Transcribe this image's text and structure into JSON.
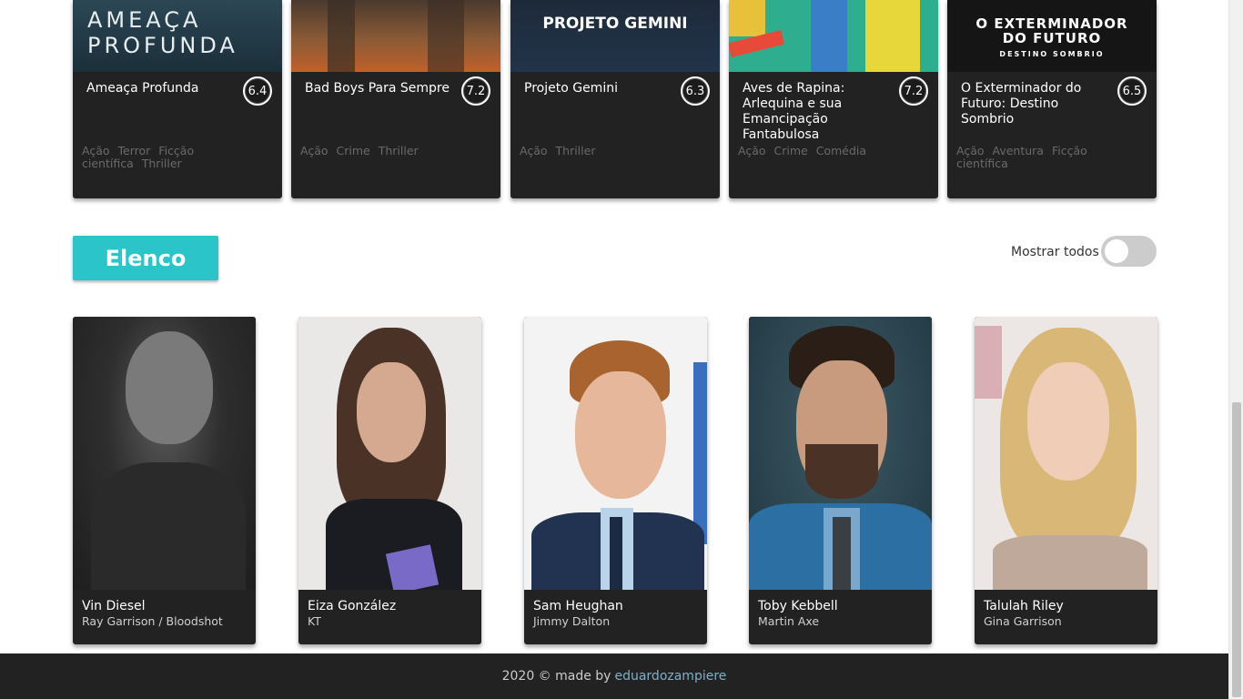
{
  "movies": [
    {
      "poster_text": "AMEAÇA PROFUNDA",
      "title": "Ameaça Profunda",
      "rating": "6.4",
      "genres": [
        "Ação",
        "Terror",
        "Ficção científica",
        "Thriller"
      ]
    },
    {
      "poster_text": "",
      "title": "Bad Boys Para Sempre",
      "rating": "7.2",
      "genres": [
        "Ação",
        "Crime",
        "Thriller"
      ]
    },
    {
      "poster_text": "PROJETO GEMINI",
      "title": "Projeto Gemini",
      "rating": "6.3",
      "genres": [
        "Ação",
        "Thriller"
      ]
    },
    {
      "poster_text": "",
      "title": "Aves de Rapina: Arlequina e sua Emancipação Fantabulosa",
      "rating": "7.2",
      "genres": [
        "Ação",
        "Crime",
        "Comédia"
      ]
    },
    {
      "poster_text": "O EXTERMINADOR DO FUTURO",
      "poster_subtext": "DESTINO SOMBRIO",
      "title": "O Exterminador do Futuro: Destino Sombrio",
      "rating": "6.5",
      "genres": [
        "Ação",
        "Aventura",
        "Ficção científica"
      ]
    }
  ],
  "elenco": {
    "title": "Elenco",
    "toggle_label": "Mostrar todos",
    "toggle_on": false
  },
  "cast": [
    {
      "name": "Vin Diesel",
      "role": "Ray Garrison / Bloodshot"
    },
    {
      "name": "Eiza González",
      "role": "KT"
    },
    {
      "name": "Sam Heughan",
      "role": "Jimmy Dalton"
    },
    {
      "name": "Toby Kebbell",
      "role": "Martin Axe"
    },
    {
      "name": "Talulah Riley",
      "role": "Gina Garrison"
    }
  ],
  "footer": {
    "text": "2020 © made by",
    "link": "eduardozampiere"
  },
  "colors": {
    "accent": "#2bc5c9",
    "card_bg": "#222222",
    "link": "#7fb0c9"
  }
}
